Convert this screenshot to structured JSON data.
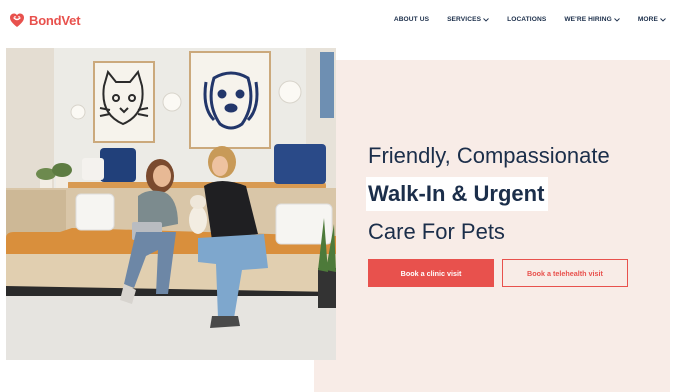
{
  "brand": {
    "name": "BondVet",
    "accent": "#e8514d",
    "navy": "#1b2e4a",
    "logo_icon": "heart-shield-icon"
  },
  "nav": {
    "items": [
      {
        "label": "ABOUT US",
        "has_dropdown": false
      },
      {
        "label": "SERVICES",
        "has_dropdown": true
      },
      {
        "label": "LOCATIONS",
        "has_dropdown": false
      },
      {
        "label": "WE'RE HIRING",
        "has_dropdown": true
      },
      {
        "label": "MORE",
        "has_dropdown": true
      }
    ],
    "dropdown_icon": "chevron-down-icon"
  },
  "hero": {
    "line1": "Friendly, Compassionate",
    "line2": "Walk-In & Urgent",
    "line3": "Care For Pets",
    "primary_button": "Book a clinic visit",
    "secondary_button": "Book a telehealth visit",
    "panel_color": "#f8ece7"
  }
}
